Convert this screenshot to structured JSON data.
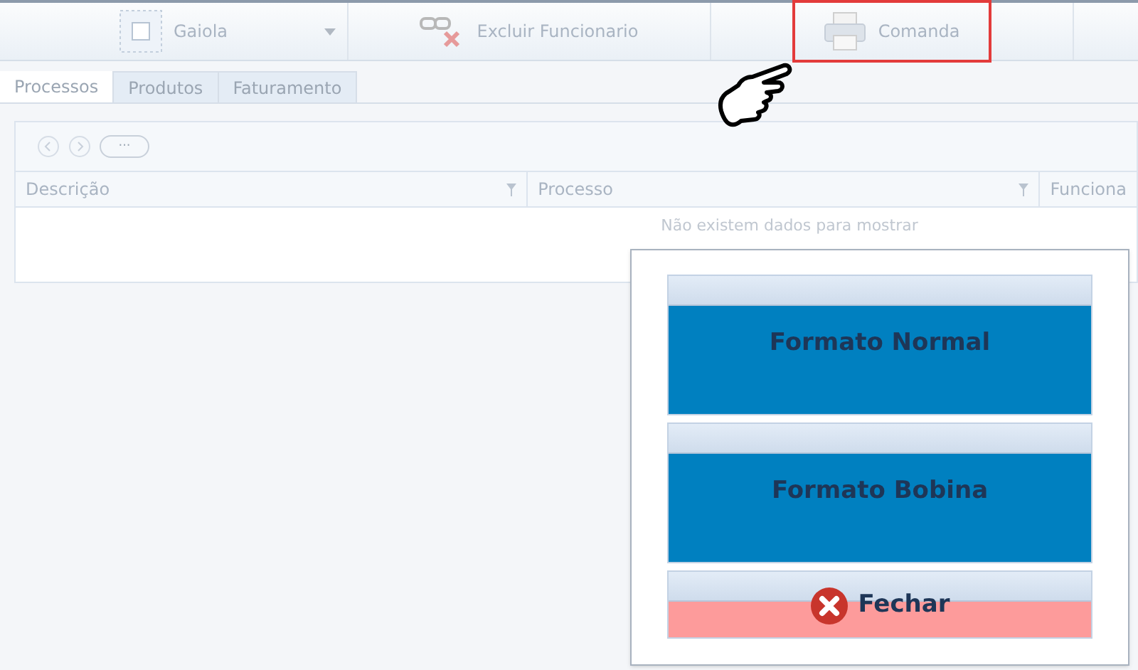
{
  "toolbar": [
    {
      "kind": "checkbox",
      "label": "Gaiola",
      "disabled": true,
      "dropdown": true,
      "highlighted": false
    },
    {
      "kind": "unlink",
      "label": "Excluir Funcionario",
      "disabled": true,
      "dropdown": false,
      "highlighted": false
    },
    {
      "kind": "printer",
      "label": "Comanda",
      "disabled": true,
      "dropdown": false,
      "highlighted": true
    }
  ],
  "tabs": [
    {
      "label": "Processos",
      "selected": true
    },
    {
      "label": "Produtos",
      "selected": false
    },
    {
      "label": "Faturamento",
      "selected": false
    }
  ],
  "pager": {
    "more_label": "···"
  },
  "table": {
    "columns": [
      "Descrição",
      "Processo",
      "Funciona"
    ],
    "empty_message": "Não existem dados para mostrar"
  },
  "dialog": {
    "buttons": [
      {
        "kind": "primary",
        "label": "Formato Normal"
      },
      {
        "kind": "primary",
        "label": "Formato Bobina"
      },
      {
        "kind": "close",
        "label": "Fechar"
      }
    ]
  }
}
